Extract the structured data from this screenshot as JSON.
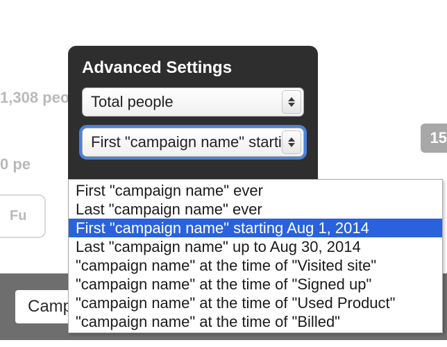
{
  "background": {
    "stat_1308": "1,308 peo",
    "stat_0": "0 pe",
    "badge_right": "15",
    "panel_text": "Fu",
    "darkbar_text": "Campai"
  },
  "popover": {
    "title": "Advanced Settings",
    "select1_value": "Total people",
    "select2_value": "First \"campaign name\" starting ."
  },
  "dropdown": {
    "options": [
      "First \"campaign name\" ever",
      "Last \"campaign name\" ever",
      "First \"campaign name\" starting Aug 1, 2014",
      "Last \"campaign name\" up to Aug 30, 2014",
      "\"campaign name\" at the time of \"Visited site\"",
      "\"campaign name\" at the time of \"Signed up\"",
      "\"campaign name\" at the time of \"Used Product\"",
      "\"campaign name\" at the time of \"Billed\""
    ],
    "selected_index": 2
  }
}
